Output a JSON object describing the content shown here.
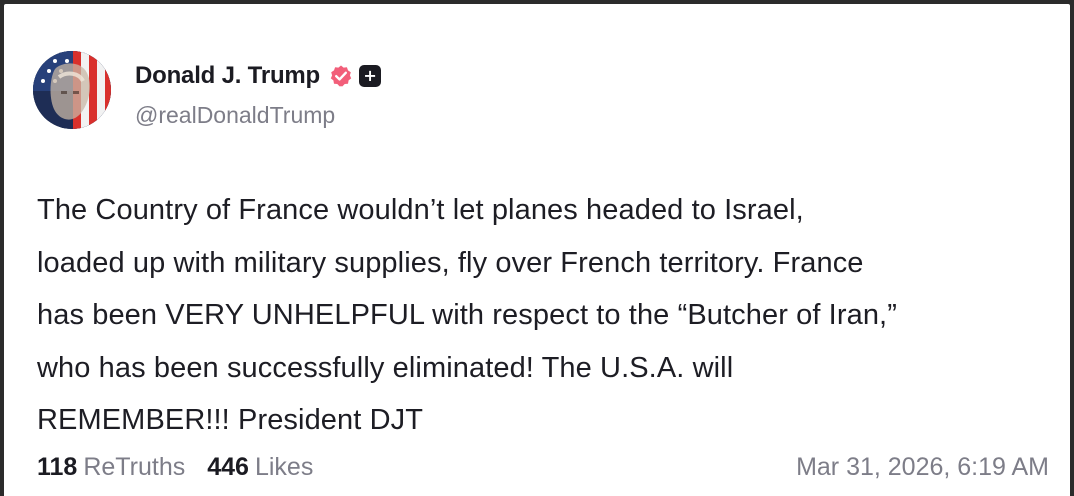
{
  "post": {
    "author_name": "Donald J. Trump",
    "author_handle": "@realDonaldTrump",
    "verified_icon": "verified-badge-icon",
    "plus_icon": "plus-icon",
    "body": "The Country of France wouldn’t let planes headed to Israel,\nloaded up with military supplies, fly over French territory. France\nhas been VERY UNHELPFUL with respect to the “Butcher of Iran,”\nwho has been successfully eliminated! The U.S.A. will\nREMEMBER!!! President DJT",
    "retruths_count": "118",
    "retruths_label": "ReTruths",
    "likes_count": "446",
    "likes_label": "Likes",
    "timestamp": "Mar 31, 2026, 6:19 AM"
  },
  "colors": {
    "verified": "#f25f7a",
    "text_primary": "#1b1b22",
    "text_secondary": "#7d7d88",
    "frame": "#2b2b2b"
  }
}
